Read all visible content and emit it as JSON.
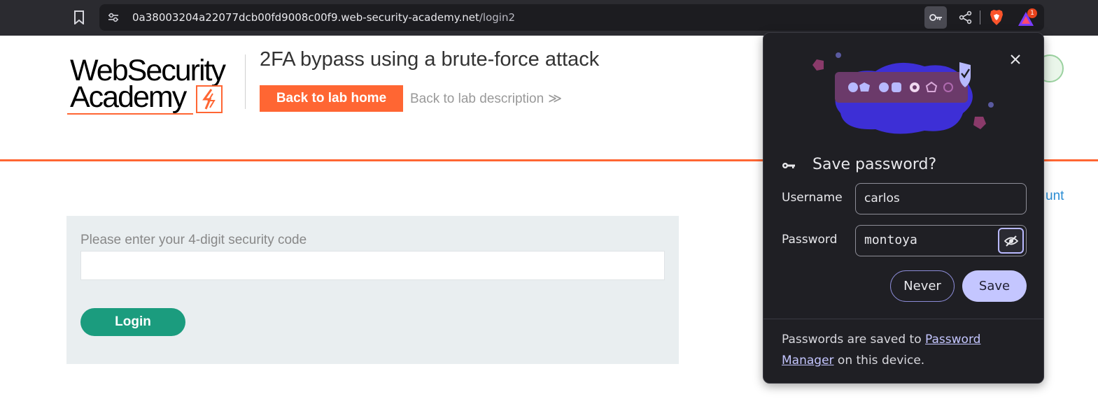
{
  "browser": {
    "url_host": "0a38003204a22077dcb00fd9008c00f9.web-security-academy.net",
    "url_path": "/login2",
    "rewards_badge": "1",
    "icons": [
      "bookmark-icon",
      "site-info-icon",
      "key-icon",
      "share-icon",
      "brave-shields-icon",
      "brave-rewards-icon"
    ]
  },
  "header": {
    "logo_line1": "WebSecurity",
    "logo_line2": "Academy",
    "lab_title": "2FA bypass using a brute-force attack",
    "back_home_label": "Back to lab home",
    "back_description_label": "Back to lab description",
    "back_description_chevron": "≫",
    "account_link_partial": "unt"
  },
  "form": {
    "code_label": "Please enter your 4-digit security code",
    "code_value": "",
    "login_label": "Login"
  },
  "password_popup": {
    "title": "Save password?",
    "username_label": "Username",
    "username_value": "carlos",
    "password_label": "Password",
    "password_value": "montoya",
    "never_label": "Never",
    "save_label": "Save",
    "footer_prefix": "Passwords are saved to ",
    "footer_link": "Password Manager",
    "footer_suffix": " on this device."
  },
  "colors": {
    "accent_orange": "#ff6633",
    "login_green": "#1b9c7e",
    "popup_bg": "#1f1f24",
    "save_btn": "#c4c6ff"
  }
}
